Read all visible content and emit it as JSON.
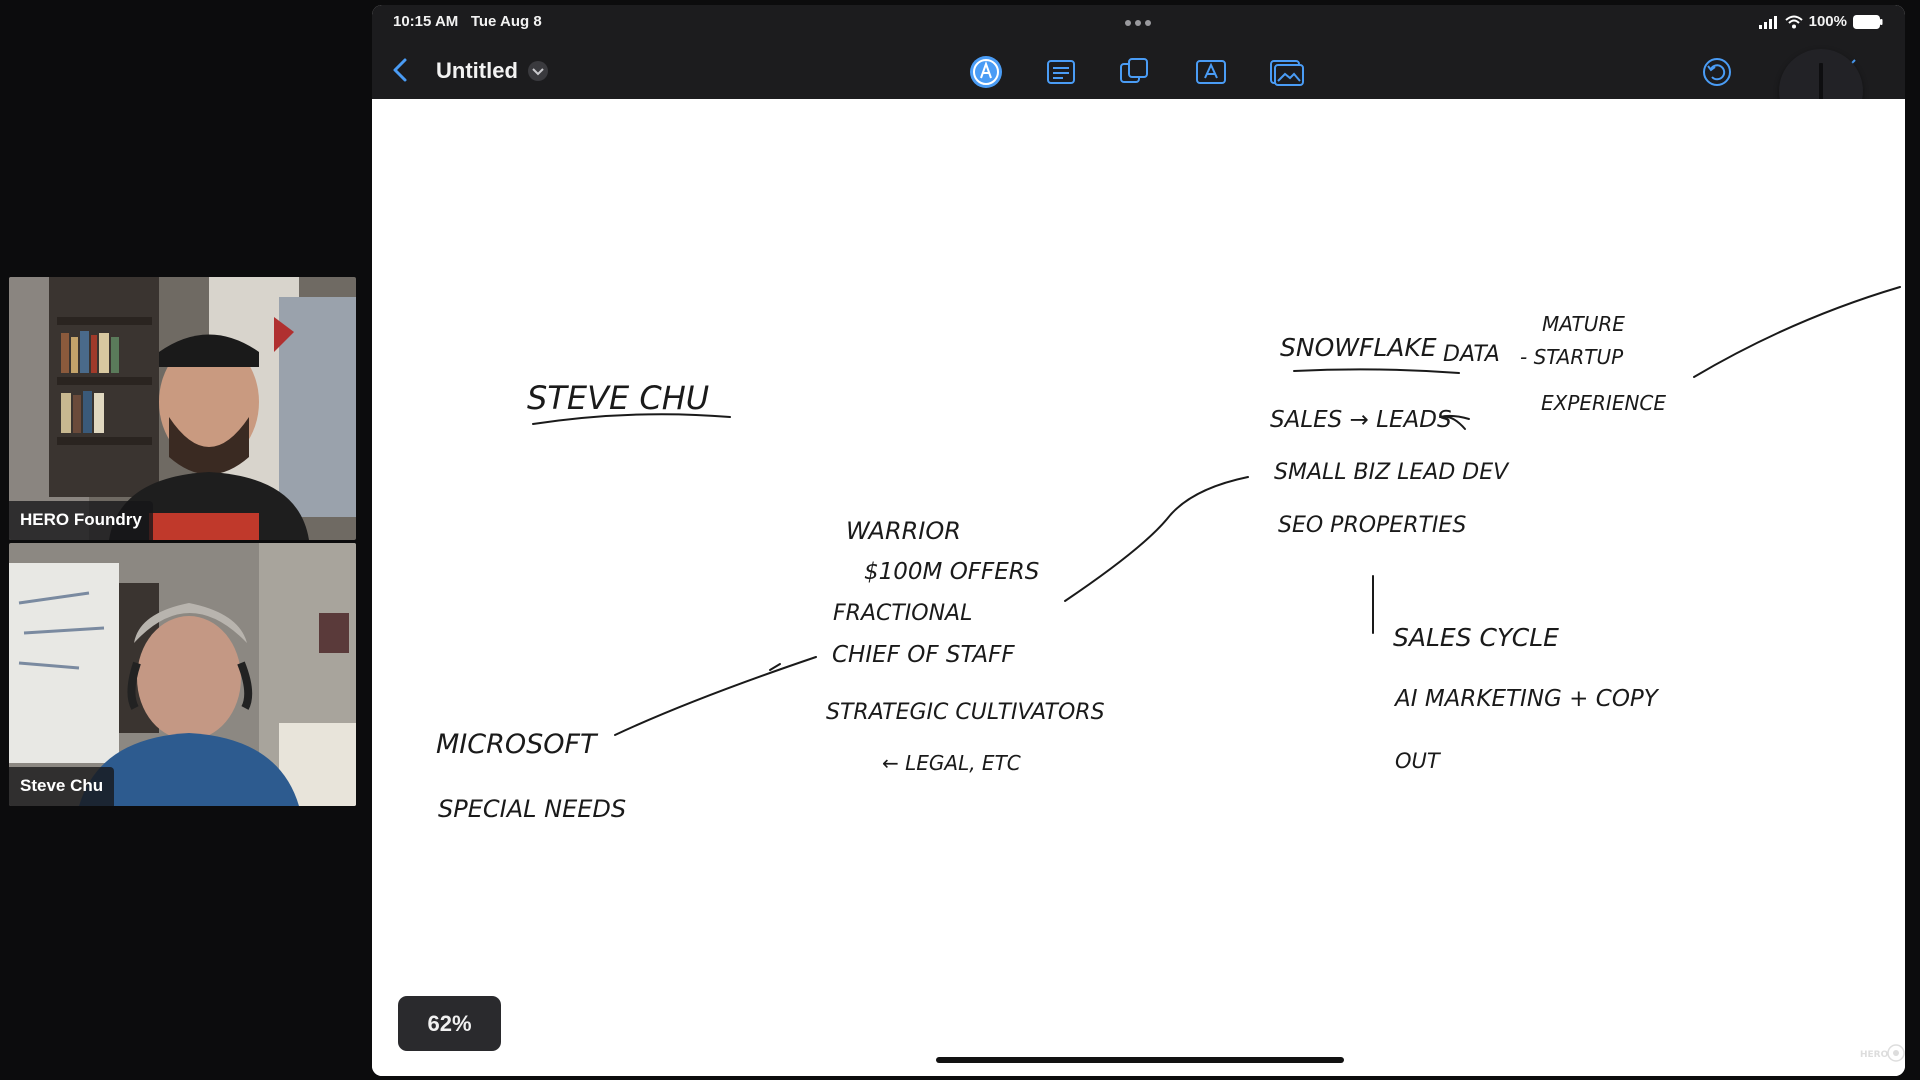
{
  "participants": [
    {
      "name": "HERO Foundry"
    },
    {
      "name": "Steve Chu"
    }
  ],
  "status_bar": {
    "time": "10:15 AM",
    "date": "Tue Aug 8",
    "battery": "100%"
  },
  "toolbar": {
    "title": "Untitled",
    "icons": [
      "back-chevron-icon",
      "title-chevron-icon",
      "pen-icon",
      "text-lines-icon",
      "shapes-icon",
      "textbox-icon",
      "image-icon",
      "undo-icon",
      "compose-icon"
    ]
  },
  "canvas": {
    "zoom": "62%",
    "notes": {
      "name": "STEVE CHU",
      "snowflake": "SNOWFLAKE",
      "data": "DATA",
      "mature": "MATURE",
      "startup": "- STARTUP",
      "experience": "EXPERIENCE",
      "sales_leads": "SALES → LEADS",
      "small_biz": "SMALL BIZ  LEAD DEV",
      "seo": "SEO  PROPERTIES",
      "warrior": "WARRIOR",
      "offers": "$100M  OFFERS",
      "fractional": "FRACTIONAL",
      "chief": "CHIEF OF STAFF",
      "strategic": "STRATEGIC  CULTIVATORS",
      "legal": "← LEGAL, ETC",
      "microsoft": "MICROSOFT",
      "special_needs": "SPECIAL NEEDS",
      "sales_cycle": "SALES  CYCLE",
      "ai_marketing": "AI  MARKETING + COPY",
      "out": "OUT"
    }
  },
  "colors": {
    "background": "#0c0c0d",
    "toolbar": "#1c1c1e",
    "canvas": "#ffffff",
    "ink": "#1a1a1a"
  }
}
